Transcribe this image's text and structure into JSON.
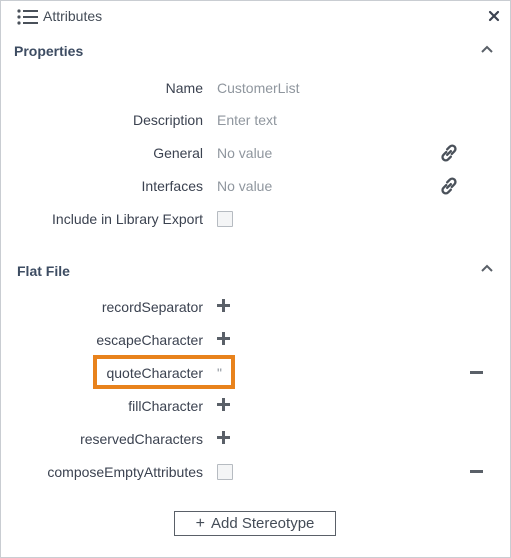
{
  "window": {
    "title": "Attributes",
    "close_symbol": "×"
  },
  "properties": {
    "section_title": "Properties",
    "name_label": "Name",
    "name_value": "CustomerList",
    "description_label": "Description",
    "description_placeholder": "Enter text",
    "general_label": "General",
    "general_value": "No value",
    "interfaces_label": "Interfaces",
    "interfaces_value": "No value",
    "library_export_label": "Include in Library Export"
  },
  "flat_file": {
    "section_title": "Flat File",
    "items": [
      {
        "label": "recordSeparator",
        "value": ""
      },
      {
        "label": "escapeCharacter",
        "value": ""
      },
      {
        "label": "quoteCharacter",
        "value": "\""
      },
      {
        "label": "fillCharacter",
        "value": ""
      },
      {
        "label": "reservedCharacters",
        "value": ""
      },
      {
        "label": "composeEmptyAttributes",
        "value": ""
      }
    ]
  },
  "footer": {
    "add_stereotype_label": "Add Stereotype",
    "add_symbol": "+"
  },
  "colors": {
    "highlight": "#e8821c",
    "text": "#3b4250",
    "muted_text": "#8f969e",
    "icon": "#5a6068"
  }
}
